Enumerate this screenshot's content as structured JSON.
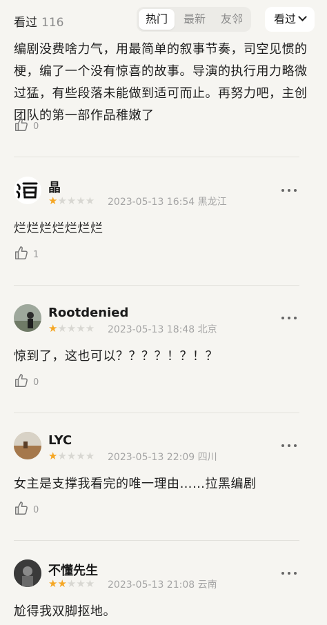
{
  "header": {
    "title": "看过",
    "count": "116",
    "tabs": [
      {
        "label": "热门",
        "active": true
      },
      {
        "label": "最新",
        "active": false
      },
      {
        "label": "友邻",
        "active": false
      }
    ],
    "filter_label": "看过"
  },
  "colors": {
    "star": "#f5a623",
    "background": "#f6f5f1"
  },
  "reviews": [
    {
      "text": "编剧没费啥力气，用最简单的叙事节奏，司空见惯的梗，编了一个没有惊喜的故事。导演的执行用力略微过猛，有些段落未能做到适可而止。再努力吧，主创团队的第一部作品稚嫩了",
      "likes": "0"
    },
    {
      "user": "晶",
      "stars": 1,
      "time": "2023-05-13 16:54 黑龙江",
      "text": "烂烂烂烂烂烂烂",
      "likes": "1"
    },
    {
      "user": "Rootdenied",
      "stars": 1,
      "time": "2023-05-13 18:48 北京",
      "text": "惊到了，这也可以？？？？！？！？",
      "likes": "0"
    },
    {
      "user": "LYC",
      "stars": 1,
      "time": "2023-05-13 22:09 四川",
      "text": "女主是支撑我看完的唯一理由……拉黑编剧",
      "likes": "0"
    },
    {
      "user": "不懂先生",
      "stars": 2,
      "time": "2023-05-13 21:08 云南",
      "text": "尬得我双脚抠地。"
    }
  ]
}
